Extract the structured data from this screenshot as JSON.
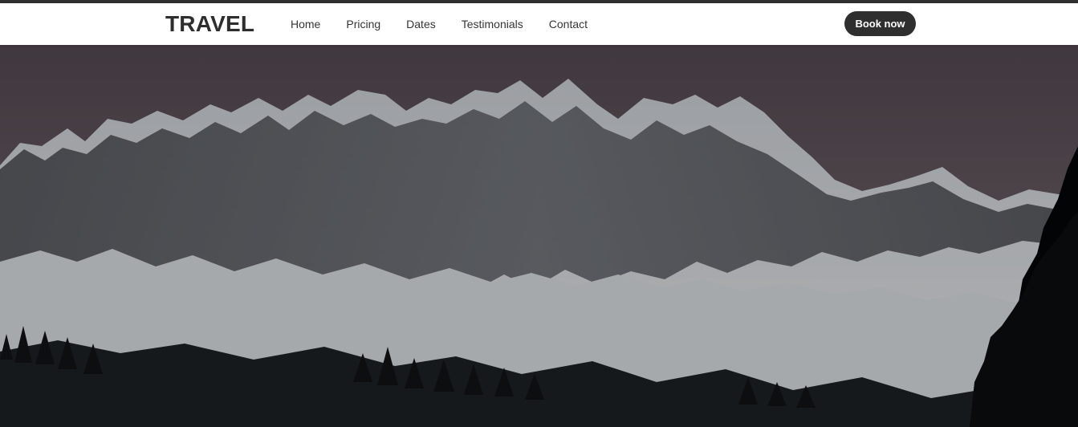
{
  "header": {
    "brand": "TRAVEL",
    "nav": [
      {
        "label": "Home"
      },
      {
        "label": "Pricing"
      },
      {
        "label": "Dates"
      },
      {
        "label": "Testimonials"
      },
      {
        "label": "Contact"
      }
    ],
    "cta_label": "Book now"
  },
  "colors": {
    "navbar_background": "#ffffff",
    "brand_text": "#2e2e2e",
    "button_background": "#2f2f2f",
    "button_text": "#ffffff",
    "hero_overlay": "#000000"
  },
  "hero": {
    "image_subject": "snowy mountain range with evergreen trees"
  }
}
